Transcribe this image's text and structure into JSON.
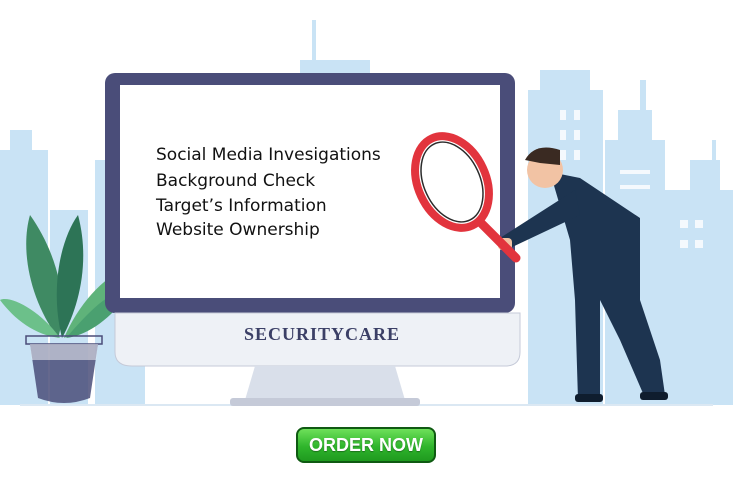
{
  "screen_lines": [
    "Social Media Invesigations",
    "Background Check",
    "Target’s Information",
    "Website Ownership"
  ],
  "brand": "SECURITYCARE",
  "order_button_label": "ORDER NOW",
  "colors": {
    "building": "#bcdcf2",
    "monitor_frame": "#4a4d79",
    "magnifier_ring": "#e2343d",
    "button_green": "#2fb52c",
    "suit": "#1d3450"
  },
  "icons": [
    "plant-illustration",
    "magnifying-glass-icon",
    "person-illustration",
    "monitor-illustration"
  ]
}
